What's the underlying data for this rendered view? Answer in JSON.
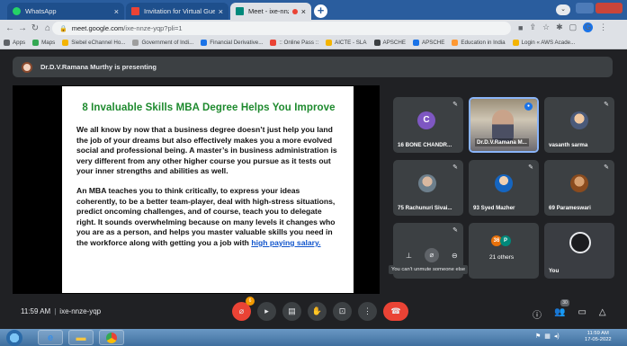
{
  "browser": {
    "tabs": [
      {
        "label": "WhatsApp",
        "icon": "whatsapp-icon",
        "color": "#25d366"
      },
      {
        "label": "Invitation for Virtual Guest Lect...",
        "icon": "gmail-icon",
        "color": "#ea4335"
      },
      {
        "label": "Meet - ixe-nnze-yqp",
        "icon": "meet-icon",
        "color": "#00897b"
      }
    ],
    "url_host": "meet.google.com",
    "url_path": "/ixe-nnze-yqp?pli=1",
    "profile_letter": "G",
    "bookmarks": [
      {
        "label": "Apps",
        "color": "#5f6368"
      },
      {
        "label": "Maps",
        "color": "#34a853"
      },
      {
        "label": "Siebel eChannel Ho...",
        "color": "#f4b400"
      },
      {
        "label": "Government of Indi...",
        "color": "#9e9e9e"
      },
      {
        "label": "Financial Derivative...",
        "color": "#1a73e8"
      },
      {
        "label": ":: Online Pass ::",
        "color": "#ea4335"
      },
      {
        "label": "AICTE - SLA",
        "color": "#f4b400"
      },
      {
        "label": "APSCHE",
        "color": "#3c4043"
      },
      {
        "label": "APSCHE",
        "color": "#1a73e8"
      },
      {
        "label": "Education in India",
        "color": "#ff9933"
      },
      {
        "label": "Login « AWS Acade...",
        "color": "#f4b400"
      }
    ]
  },
  "meet": {
    "presenting": "Dr.D.V.Ramana Murthy is presenting",
    "slide": {
      "title": "8 Invaluable Skills MBA Degree Helps You Improve",
      "para1": "We all know by now that a business degree doesn’t just help you land the job of your dreams but also effectively makes you a more evolved social and professional being. A master’s in business administration is very different from any other higher course you pursue as it tests out your inner strengths and abilities as well.",
      "para2": "An MBA teaches you to think critically, to express your ideas coherently, to be a better team-player, deal with high-stress situations, predict oncoming challenges, and of course, teach you to delegate right. It sounds overwhelming because on many levels it changes who you are as a person, and helps you master valuable skills you need in the workforce along with getting you a job with",
      "link": "high paying salary."
    },
    "participants": [
      {
        "name": "16 BONE CHANDR...",
        "letter": "C"
      },
      {
        "name": "Dr.D.V.Ramana M..."
      },
      {
        "name": "vasanth sarma"
      },
      {
        "name": "75 Rachunuri Sivai..."
      },
      {
        "name": "93 Syed Mazher"
      },
      {
        "name": "69 Parameswari"
      },
      {
        "name": "21 others",
        "letters": [
          "36",
          "P"
        ]
      },
      {
        "name": "You"
      }
    ],
    "tooltip": "You can't unmute someone else",
    "time": "11:59 AM",
    "meeting_code": "ixe-nnze-yqp",
    "people_count": "30",
    "reaction_badge": "6"
  },
  "taskbar": {
    "time": "11:59 AM",
    "date": "17-05-2022"
  }
}
